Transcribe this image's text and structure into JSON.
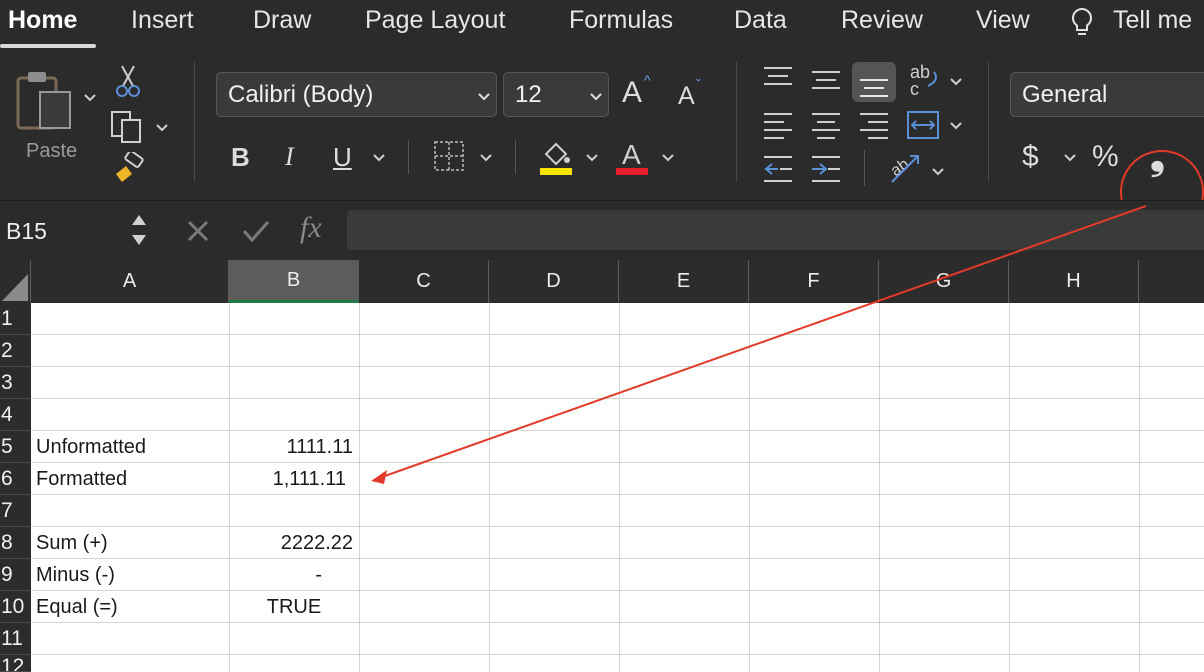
{
  "menu": {
    "tabs": [
      {
        "label": "Home"
      },
      {
        "label": "Insert"
      },
      {
        "label": "Draw"
      },
      {
        "label": "Page Layout"
      },
      {
        "label": "Formulas"
      },
      {
        "label": "Data"
      },
      {
        "label": "Review"
      },
      {
        "label": "View"
      }
    ],
    "tell_me": "Tell me"
  },
  "ribbon": {
    "paste_label": "Paste",
    "font_name": "Calibri (Body)",
    "font_size": "12",
    "grow_font_glyph": "A",
    "shrink_font_glyph": "A",
    "bold": "B",
    "italic": "I",
    "underline": "U",
    "number_format": "General",
    "currency_glyph": "$",
    "percent_glyph": "%",
    "comma_glyph": "❟",
    "accent_colors": {
      "highlight": "#f5e400",
      "font_color": "#e8202c",
      "annotation": "#e23b2a"
    }
  },
  "formula_bar": {
    "name_box": "B15",
    "fx": "fx",
    "formula": ""
  },
  "sheet": {
    "columns": [
      "A",
      "B",
      "C",
      "D",
      "E",
      "F",
      "G",
      "H"
    ],
    "selected_column": "B",
    "rows": [
      "1",
      "2",
      "3",
      "4",
      "5",
      "6",
      "7",
      "8",
      "9",
      "10",
      "11",
      "12"
    ],
    "cells": {
      "A5": "Unformatted",
      "B5": "1111.11",
      "A6": "Formatted",
      "B6": "1,111.11",
      "A8": "Sum (+)",
      "B8": "2222.22",
      "A9": "Minus (-)",
      "B9": "-",
      "A10": "Equal (=)",
      "B10": "TRUE"
    }
  }
}
